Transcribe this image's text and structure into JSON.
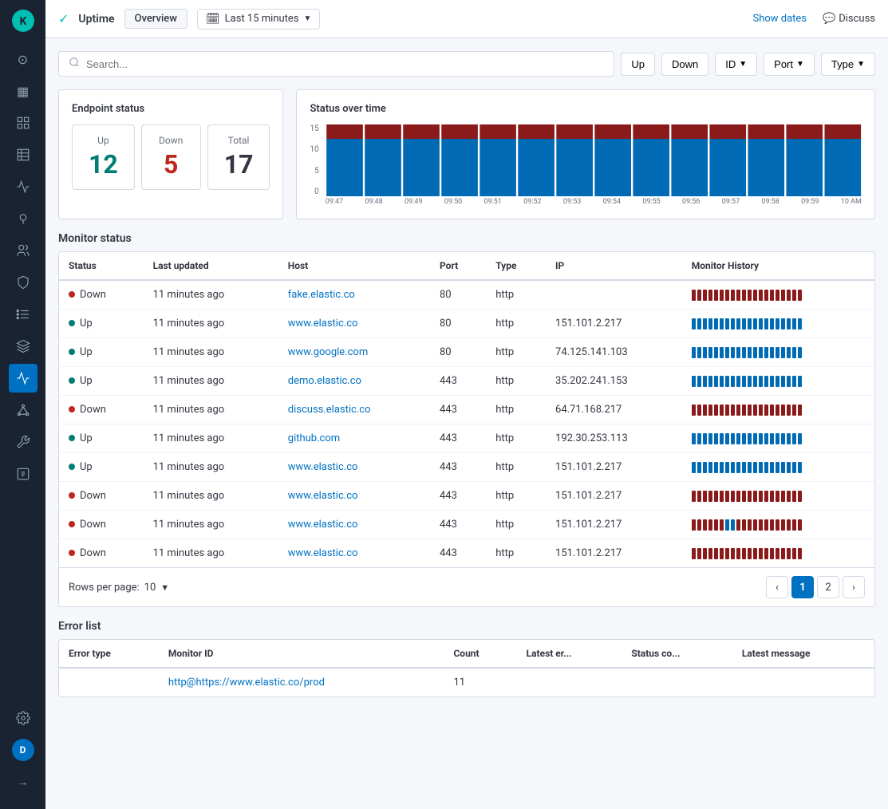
{
  "sidebar": {
    "logo_initial": "K",
    "items": [
      {
        "name": "home-icon",
        "icon": "⊙",
        "active": false
      },
      {
        "name": "dashboard-icon",
        "icon": "▦",
        "active": false
      },
      {
        "name": "layers-icon",
        "icon": "≡",
        "active": false
      },
      {
        "name": "table-icon",
        "icon": "⊞",
        "active": false
      },
      {
        "name": "chart-icon",
        "icon": "📊",
        "active": false
      },
      {
        "name": "pin-icon",
        "icon": "◎",
        "active": false
      },
      {
        "name": "people-icon",
        "icon": "✦",
        "active": false
      },
      {
        "name": "shield-icon",
        "icon": "🛡",
        "active": false
      },
      {
        "name": "list-icon",
        "icon": "☰",
        "active": false
      },
      {
        "name": "stack-icon",
        "icon": "⧉",
        "active": false
      },
      {
        "name": "uptime-icon",
        "icon": "↑",
        "active": true
      },
      {
        "name": "nodes-icon",
        "icon": "⬡",
        "active": false
      },
      {
        "name": "wrench-icon",
        "icon": "🔧",
        "active": false
      },
      {
        "name": "ml-icon",
        "icon": "◈",
        "active": false
      },
      {
        "name": "settings-icon",
        "icon": "⚙",
        "active": false
      }
    ],
    "user_initial": "D",
    "arrow_icon": "→"
  },
  "topbar": {
    "check_icon": "✓",
    "uptime_label": "Uptime",
    "tab_overview": "Overview",
    "time_icon": "🗓",
    "time_value": "Last 15 minutes",
    "show_dates_label": "Show dates",
    "discuss_icon": "💬",
    "discuss_label": "Discuss"
  },
  "search": {
    "placeholder": "Search...",
    "filter_up": "Up",
    "filter_down": "Down",
    "filter_id": "ID",
    "filter_port": "Port",
    "filter_type": "Type"
  },
  "endpoint_status": {
    "title": "Endpoint status",
    "up_label": "Up",
    "up_value": "12",
    "down_label": "Down",
    "down_value": "5",
    "total_label": "Total",
    "total_value": "17"
  },
  "status_over_time": {
    "title": "Status over time",
    "y_labels": [
      "15",
      "10",
      "5",
      "0"
    ],
    "x_labels": [
      "09:47",
      "09:48",
      "09:49",
      "09:50",
      "09:51",
      "09:52",
      "09:53",
      "09:54",
      "09:55",
      "09:56",
      "09:57",
      "09:58",
      "09:59",
      "10 AM"
    ],
    "colors": {
      "down_bar": "#8b1a1a",
      "up_bar": "#006bb4"
    }
  },
  "monitor_status": {
    "section_title": "Monitor status",
    "columns": [
      "Status",
      "Last updated",
      "Host",
      "Port",
      "Type",
      "IP",
      "Monitor History"
    ],
    "rows": [
      {
        "status": "Down",
        "last_updated": "11 minutes ago",
        "host": "fake.elastic.co",
        "port": "80",
        "type": "http",
        "ip": "",
        "history": [
          0,
          0,
          0,
          0,
          0,
          0,
          0,
          0,
          0,
          0,
          0,
          0,
          0,
          0,
          0,
          0,
          0,
          0,
          0,
          0
        ]
      },
      {
        "status": "Up",
        "last_updated": "11 minutes ago",
        "host": "www.elastic.co",
        "port": "80",
        "type": "http",
        "ip": "151.101.2.217",
        "history": [
          1,
          1,
          1,
          1,
          1,
          1,
          1,
          1,
          1,
          1,
          1,
          1,
          1,
          1,
          1,
          1,
          1,
          1,
          1,
          1
        ]
      },
      {
        "status": "Up",
        "last_updated": "11 minutes ago",
        "host": "www.google.com",
        "port": "80",
        "type": "http",
        "ip": "74.125.141.103",
        "history": [
          1,
          1,
          1,
          1,
          1,
          1,
          1,
          1,
          1,
          1,
          1,
          1,
          1,
          1,
          1,
          1,
          1,
          1,
          1,
          1
        ]
      },
      {
        "status": "Up",
        "last_updated": "11 minutes ago",
        "host": "demo.elastic.co",
        "port": "443",
        "type": "http",
        "ip": "35.202.241.153",
        "history": [
          1,
          1,
          1,
          1,
          1,
          1,
          1,
          1,
          1,
          1,
          1,
          1,
          1,
          1,
          1,
          1,
          1,
          1,
          1,
          1
        ]
      },
      {
        "status": "Down",
        "last_updated": "11 minutes ago",
        "host": "discuss.elastic.co",
        "port": "443",
        "type": "http",
        "ip": "64.71.168.217",
        "history": [
          0,
          0,
          0,
          0,
          0,
          0,
          0,
          0,
          0,
          0,
          0,
          0,
          0,
          0,
          0,
          0,
          0,
          0,
          0,
          0
        ]
      },
      {
        "status": "Up",
        "last_updated": "11 minutes ago",
        "host": "github.com",
        "port": "443",
        "type": "http",
        "ip": "192.30.253.113",
        "history": [
          1,
          1,
          1,
          1,
          1,
          1,
          1,
          1,
          1,
          1,
          1,
          1,
          1,
          1,
          1,
          1,
          1,
          1,
          1,
          1
        ]
      },
      {
        "status": "Up",
        "last_updated": "11 minutes ago",
        "host": "www.elastic.co",
        "port": "443",
        "type": "http",
        "ip": "151.101.2.217",
        "history": [
          1,
          1,
          1,
          1,
          1,
          1,
          1,
          1,
          1,
          1,
          1,
          1,
          1,
          1,
          1,
          1,
          1,
          1,
          1,
          1
        ]
      },
      {
        "status": "Down",
        "last_updated": "11 minutes ago",
        "host": "www.elastic.co",
        "port": "443",
        "type": "http",
        "ip": "151.101.2.217",
        "history": [
          0,
          0,
          0,
          0,
          0,
          0,
          0,
          0,
          0,
          0,
          0,
          0,
          0,
          0,
          0,
          0,
          0,
          0,
          0,
          0
        ]
      },
      {
        "status": "Down",
        "last_updated": "11 minutes ago",
        "host": "www.elastic.co",
        "port": "443",
        "type": "http",
        "ip": "151.101.2.217",
        "history": [
          0,
          0,
          0,
          0,
          0,
          0,
          1,
          1,
          0,
          0,
          0,
          0,
          0,
          0,
          0,
          0,
          0,
          0,
          0,
          0
        ]
      },
      {
        "status": "Down",
        "last_updated": "11 minutes ago",
        "host": "www.elastic.co",
        "port": "443",
        "type": "http",
        "ip": "151.101.2.217",
        "history": [
          0,
          0,
          0,
          0,
          0,
          0,
          0,
          0,
          0,
          0,
          0,
          0,
          0,
          0,
          0,
          0,
          0,
          0,
          0,
          0
        ]
      }
    ],
    "pagination": {
      "rows_per_page_label": "Rows per page:",
      "rows_per_page_value": "10",
      "current_page": 1,
      "total_pages": 2
    }
  },
  "error_list": {
    "title": "Error list",
    "columns": [
      "Error type",
      "Monitor ID",
      "Count",
      "Latest er...",
      "Status co...",
      "Latest message"
    ],
    "rows": [
      {
        "error_type": "",
        "monitor_id": "http@https://www.elastic.co/prod",
        "count": "11",
        "latest_error": "",
        "status_code": "",
        "latest_message": ""
      }
    ]
  }
}
